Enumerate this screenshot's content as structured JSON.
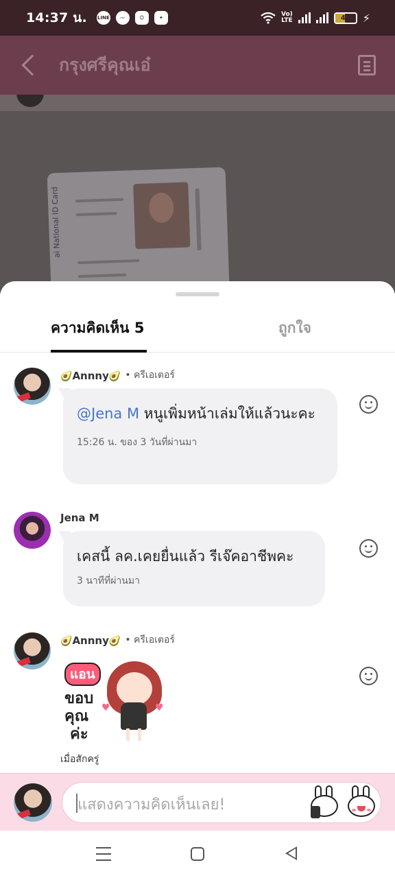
{
  "status_bar": {
    "time": "14:37 น.",
    "apps": [
      "LINE",
      "messenger",
      "app",
      "app"
    ],
    "volte_top": "Vo)",
    "volte_bottom": "LTE",
    "battery_level": "46",
    "battery_fraction": 0.46
  },
  "header": {
    "title": "กรุงศรีคุณเอ๋"
  },
  "post": {
    "id_card_text": "ai National ID Card"
  },
  "tabs": {
    "comments": "ความคิดเห็น 5",
    "likes": "ถูกใจ"
  },
  "comments": [
    {
      "avo_left": "🥑",
      "name": "Annny",
      "avo_right": "🥑",
      "role": "• ครีเอเตอร์",
      "mention": "@Jena M",
      "text": " หนูเพิ่มหน้าเล่มให้แล้วนะคะ",
      "time": "15:26 น. ของ 3 วันที่ผ่านมา"
    },
    {
      "name": "Jena M",
      "text": "เคสนี้ ลค.เคยยื่นแล้ว รีเจ๊คอาชีพคะ",
      "time": "3 นาทีที่ผ่านมา"
    },
    {
      "avo_left": "🥑",
      "name": "Annny",
      "avo_right": "🥑",
      "role": "• ครีเอเตอร์",
      "sticker": {
        "badge": "แอน",
        "line1": "ขอบ",
        "line2": "คุณ",
        "line3": "ค่ะ"
      },
      "time": "เมื่อสักครู่"
    }
  ],
  "input": {
    "placeholder": "แสดงความคิดเห็นเลย!"
  },
  "colors": {
    "accent_pink": "#fbdce6",
    "header": "#6c3d4c",
    "mention": "#4a74c9"
  },
  "icons": [
    "back-icon",
    "document-icon",
    "smiley-icon",
    "menu-icon",
    "home-icon",
    "nav-back-icon",
    "wifi-icon",
    "signal-icon",
    "battery-icon",
    "charging-icon"
  ]
}
